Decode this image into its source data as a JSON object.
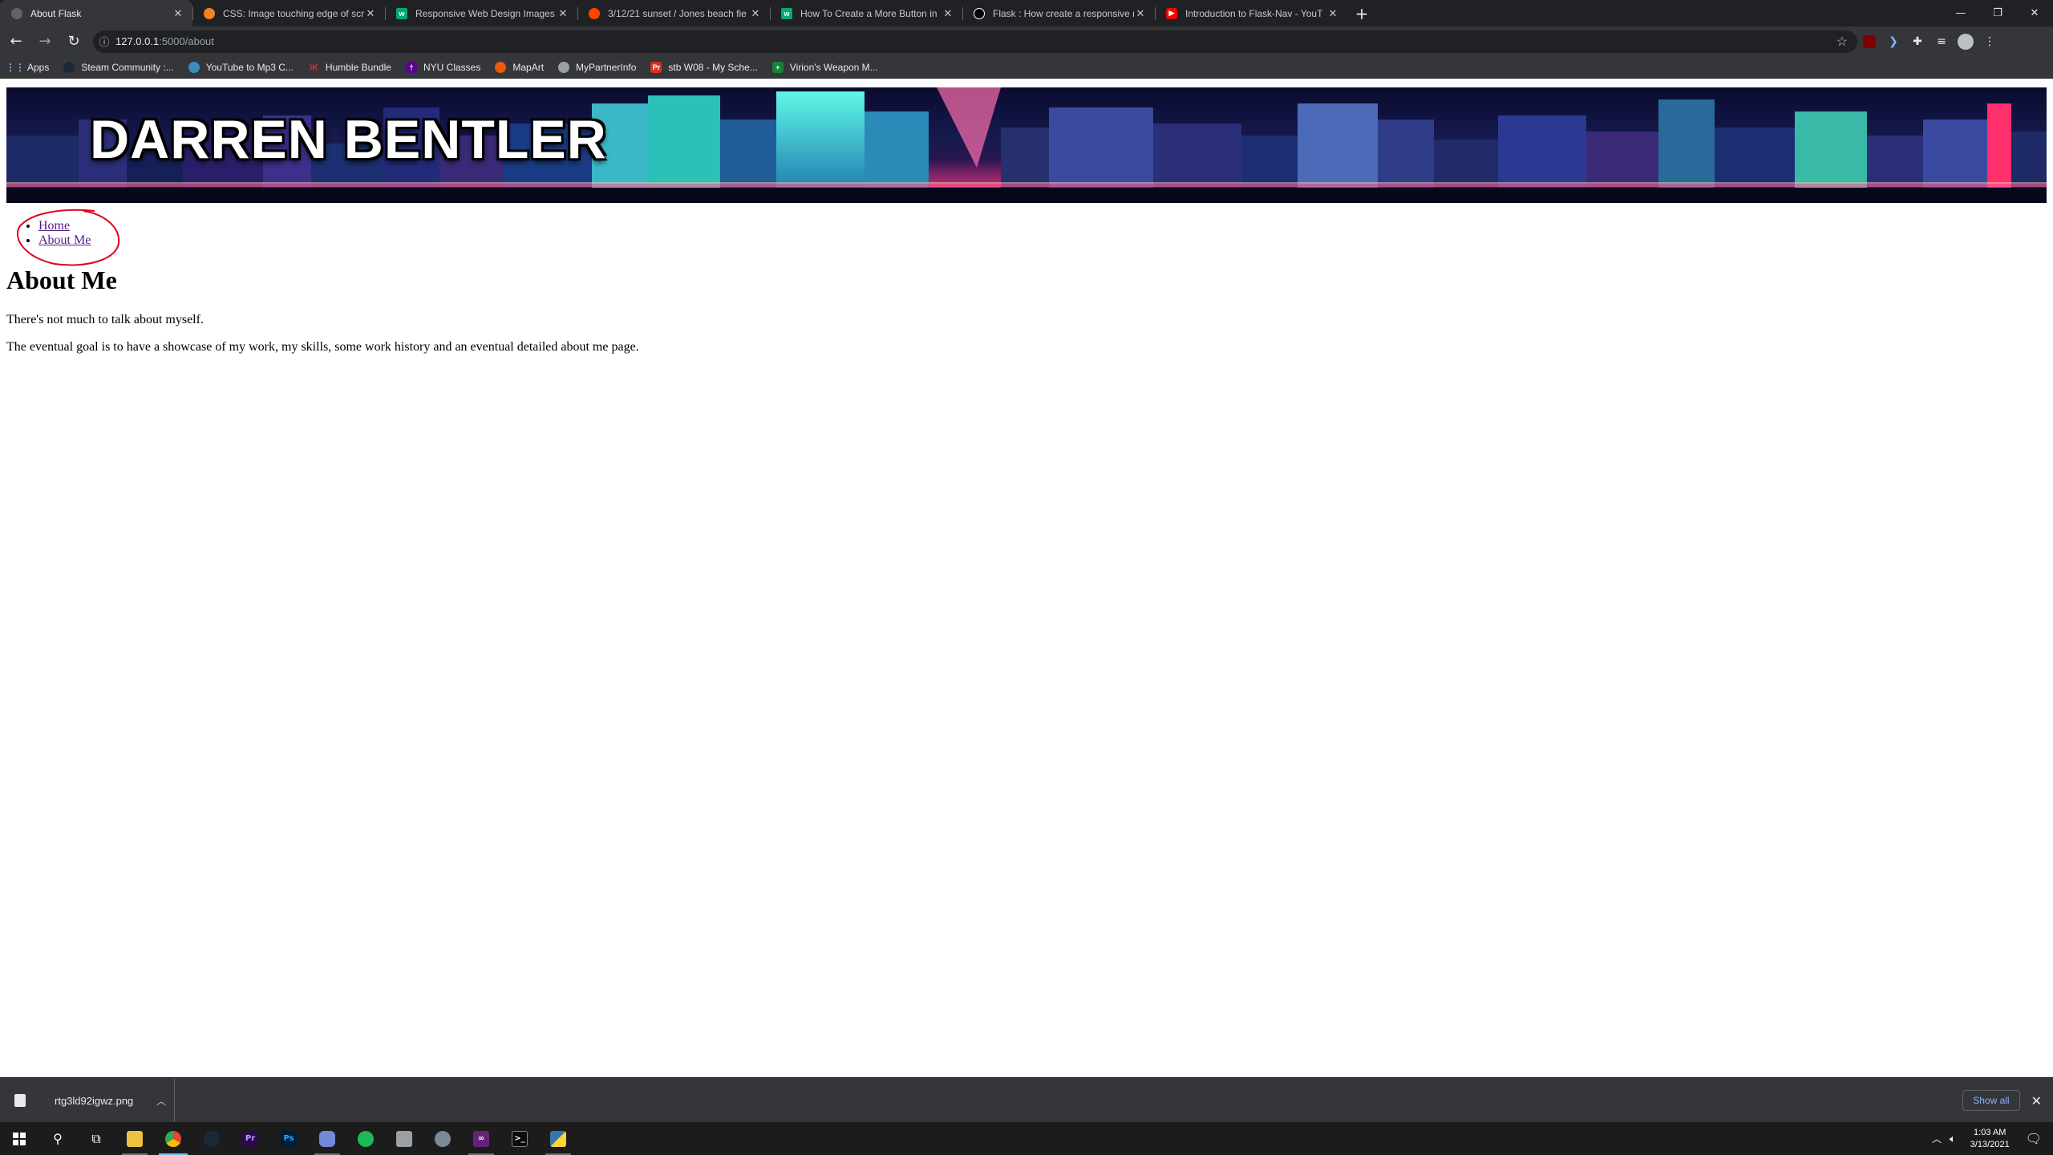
{
  "browser": {
    "tabs": [
      {
        "title": "About Flask",
        "favicon_color": "#5f6368",
        "active": true
      },
      {
        "title": "CSS: Image touching edge of scr",
        "favicon_color": "#f48024",
        "active": false
      },
      {
        "title": "Responsive Web Design Images",
        "favicon_color": "#04aa6d",
        "active": false
      },
      {
        "title": "3/12/21 sunset / Jones beach fie",
        "favicon_color": "#ff4500",
        "active": false
      },
      {
        "title": "How To Create a More Button in",
        "favicon_color": "#04aa6d",
        "active": false
      },
      {
        "title": "Flask : How create a responsive n",
        "favicon_color": "#000000",
        "active": false
      },
      {
        "title": "Introduction to Flask-Nav - YouT",
        "favicon_color": "#ff0000",
        "active": false
      }
    ],
    "url_host": "127.0.0.1",
    "url_path": ":5000/about",
    "bookmarks": [
      {
        "label": "Apps",
        "color": "#8ab4f8"
      },
      {
        "label": "Steam Community :...",
        "color": "#1b2838"
      },
      {
        "label": "YouTube to Mp3 C...",
        "color": "#3c8dbc"
      },
      {
        "label": "Humble Bundle",
        "color": "#cc2929"
      },
      {
        "label": "NYU Classes",
        "color": "#57068c"
      },
      {
        "label": "MapArt",
        "color": "#e8590c"
      },
      {
        "label": "MyPartnerInfo",
        "color": "#9aa0a6"
      },
      {
        "label": "stb W08 - My Sche...",
        "color": "#d93025"
      },
      {
        "label": "Virion's Weapon M...",
        "color": "#188038"
      }
    ]
  },
  "page": {
    "banner_title": "DARREN BENTLER",
    "nav": [
      "Home",
      "About Me"
    ],
    "heading": "About Me",
    "paragraphs": [
      "There's not much to talk about myself.",
      "The eventual goal is to have a showcase of my work, my skills, some work history and an eventual detailed about me page."
    ]
  },
  "downloads": {
    "filename": "rtg3ld92igwz.png",
    "show_all": "Show all"
  },
  "taskbar": {
    "time": "1:03 AM",
    "date": "3/13/2021"
  }
}
